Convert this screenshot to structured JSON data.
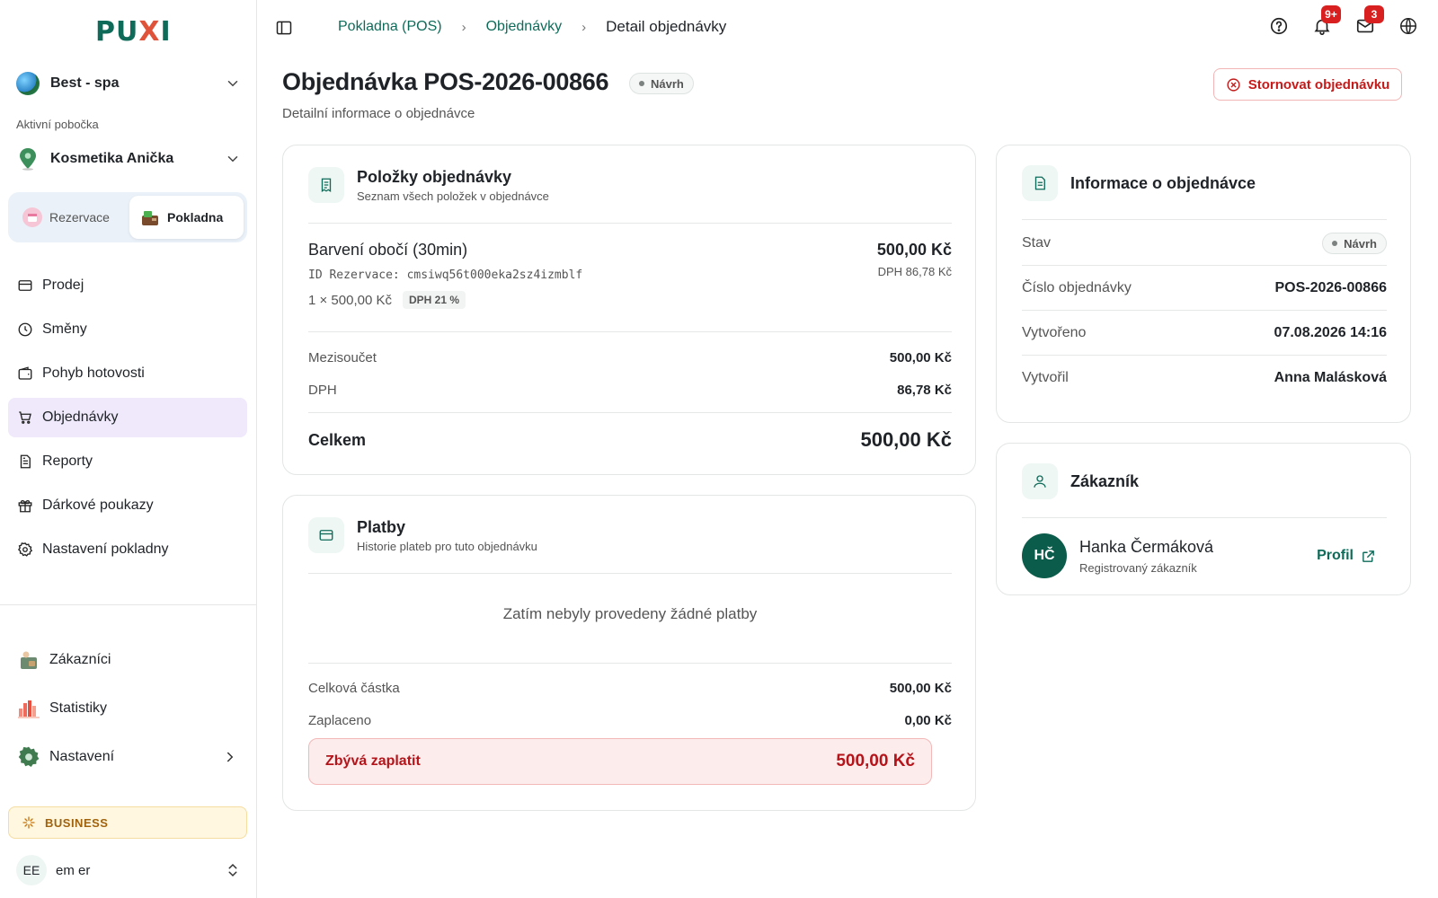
{
  "brand": {
    "logo_main": "PU",
    "logo_accent": "X",
    "logo_end": "I",
    "primary_color": "#0f6b59",
    "accent_color": "#e0533b"
  },
  "sidebar": {
    "org_name": "Best - spa",
    "branch_label": "Aktivní pobočka",
    "branch_name": "Kosmetika Anička",
    "switcher": {
      "reservations": "Rezervace",
      "pos": "Pokladna"
    },
    "nav": [
      {
        "label": "Prodej",
        "icon": "card-icon"
      },
      {
        "label": "Směny",
        "icon": "clock-icon"
      },
      {
        "label": "Pohyb hotovosti",
        "icon": "wallet-icon"
      },
      {
        "label": "Objednávky",
        "icon": "cart-icon",
        "active": true
      },
      {
        "label": "Reporty",
        "icon": "report-icon"
      },
      {
        "label": "Dárkové poukazy",
        "icon": "gift-icon"
      },
      {
        "label": "Nastavení pokladny",
        "icon": "gear-icon"
      }
    ],
    "nav2": [
      {
        "label": "Zákazníci",
        "icon": "customers-icon"
      },
      {
        "label": "Statistiky",
        "icon": "stats-icon"
      },
      {
        "label": "Nastavení",
        "icon": "settings-icon"
      }
    ],
    "plan_badge": "BUSINESS",
    "user": {
      "initials": "EE",
      "name": "em er"
    }
  },
  "topbar": {
    "breadcrumb": [
      "Pokladna (POS)",
      "Objednávky",
      "Detail objednávky"
    ],
    "notifications_badge": "9+",
    "messages_badge": "3"
  },
  "page": {
    "title": "Objednávka POS-2026-00866",
    "status": "Návrh",
    "subtitle": "Detailní informace o objednávce",
    "cancel_label": "Stornovat objednávku"
  },
  "items_card": {
    "title": "Položky objednávky",
    "subtitle": "Seznam všech položek v objednávce",
    "item": {
      "name": "Barvení obočí (30min)",
      "reservation_id": "ID Rezervace: cmsiwq56t000eka2sz4izmblf",
      "quantity_line": "1 × 500,00 Kč",
      "vat_tag": "DPH 21 %",
      "price": "500,00 Kč",
      "vat_line": "DPH 86,78 Kč"
    },
    "subtotal_label": "Mezisoučet",
    "subtotal_value": "500,00 Kč",
    "vat_label": "DPH",
    "vat_value": "86,78 Kč",
    "total_label": "Celkem",
    "total_value": "500,00 Kč"
  },
  "payments_card": {
    "title": "Platby",
    "subtitle": "Historie plateb pro tuto objednávku",
    "empty": "Zatím nebyly provedeny žádné platby",
    "total_label": "Celková částka",
    "total_value": "500,00 Kč",
    "paid_label": "Zaplaceno",
    "paid_value": "0,00 Kč",
    "remaining_label": "Zbývá zaplatit",
    "remaining_value": "500,00 Kč"
  },
  "info_card": {
    "title": "Informace o objednávce",
    "status_label": "Stav",
    "status_value": "Návrh",
    "number_label": "Číslo objednávky",
    "number_value": "POS-2026-00866",
    "created_label": "Vytvořeno",
    "created_value": "07.08.2026 14:16",
    "creator_label": "Vytvořil",
    "creator_value": "Anna Malásková"
  },
  "customer_card": {
    "title": "Zákazník",
    "initials": "HČ",
    "name": "Hanka Čermáková",
    "type": "Registrovaný zákazník",
    "profile_label": "Profil"
  }
}
